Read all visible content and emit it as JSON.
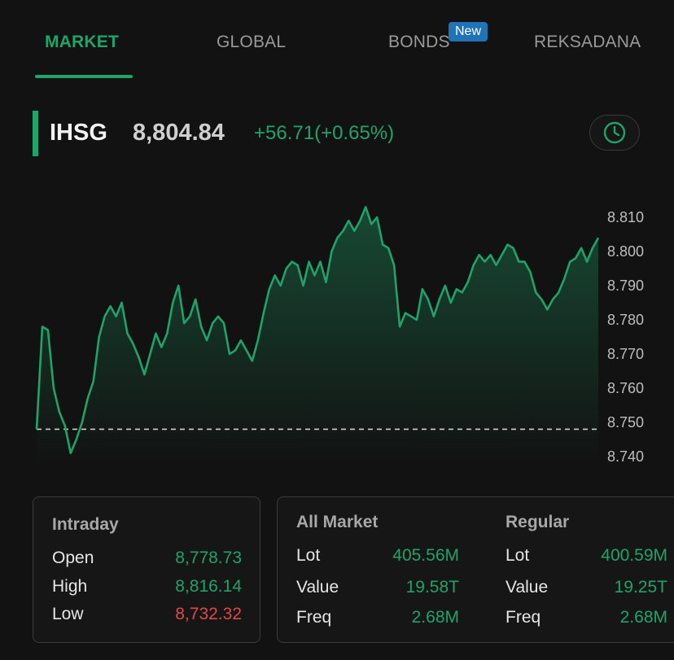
{
  "tabs": [
    {
      "label": "MARKET",
      "active": true
    },
    {
      "label": "GLOBAL",
      "active": false
    },
    {
      "label": "BONDS",
      "active": false,
      "badge": "New"
    },
    {
      "label": "REKSADANA",
      "active": false
    }
  ],
  "index": {
    "name": "IHSG",
    "value": "8,804.84",
    "change": "+56.71(+0.65%)"
  },
  "icons": {
    "history": "clock-icon"
  },
  "colors": {
    "up": "#1fa36b",
    "down": "#e04848",
    "badge": "#1f73b6"
  },
  "chart_data": {
    "type": "area",
    "ylim": [
      8.738,
      8.816
    ],
    "yticks": [
      "8.810",
      "8.800",
      "8.790",
      "8.780",
      "8.770",
      "8.760",
      "8.750",
      "8.740"
    ],
    "baseline": 8.748,
    "x": [
      0,
      1,
      2,
      3,
      4,
      5,
      6,
      7,
      8,
      9,
      10,
      11,
      12,
      13,
      14,
      15,
      16,
      17,
      18,
      19,
      20,
      21,
      22,
      23,
      24,
      25,
      26,
      27,
      28,
      29,
      30,
      31,
      32,
      33,
      34,
      35,
      36,
      37,
      38,
      39,
      40,
      41,
      42,
      43,
      44,
      45,
      46,
      47,
      48,
      49,
      50,
      51,
      52,
      53,
      54,
      55,
      56,
      57,
      58,
      59,
      60,
      61,
      62,
      63,
      64,
      65,
      66,
      67,
      68,
      69,
      70,
      71,
      72,
      73,
      74,
      75,
      76,
      77,
      78,
      79,
      80,
      81,
      82,
      83,
      84,
      85,
      86,
      87,
      88,
      89,
      90,
      91,
      92,
      93,
      94,
      95,
      96,
      97,
      98,
      99
    ],
    "values": [
      8.748,
      8.778,
      8.777,
      8.76,
      8.753,
      8.749,
      8.741,
      8.745,
      8.75,
      8.757,
      8.762,
      8.775,
      8.781,
      8.784,
      8.781,
      8.785,
      8.776,
      8.773,
      8.769,
      8.764,
      8.77,
      8.776,
      8.772,
      8.776,
      8.785,
      8.79,
      8.779,
      8.781,
      8.786,
      8.778,
      8.774,
      8.779,
      8.781,
      8.779,
      8.77,
      8.771,
      8.774,
      8.771,
      8.768,
      8.774,
      8.782,
      8.789,
      8.793,
      8.79,
      8.795,
      8.797,
      8.796,
      8.79,
      8.797,
      8.793,
      8.797,
      8.791,
      8.8,
      8.804,
      8.806,
      8.809,
      8.806,
      8.809,
      8.813,
      8.808,
      8.81,
      8.802,
      8.801,
      8.796,
      8.778,
      8.782,
      8.781,
      8.78,
      8.789,
      8.786,
      8.781,
      8.786,
      8.79,
      8.785,
      8.789,
      8.788,
      8.791,
      8.796,
      8.799,
      8.797,
      8.799,
      8.796,
      8.799,
      8.802,
      8.801,
      8.797,
      8.797,
      8.794,
      8.788,
      8.786,
      8.783,
      8.786,
      8.788,
      8.792,
      8.797,
      8.798,
      8.801,
      8.797,
      8.801,
      8.804
    ]
  },
  "intraday": {
    "title": "Intraday",
    "rows": [
      {
        "label": "Open",
        "value": "8,778.73"
      },
      {
        "label": "High",
        "value": "8,816.14"
      },
      {
        "label": "Low",
        "value": "8,732.32"
      }
    ]
  },
  "market": {
    "all_title": "All Market",
    "regular_title": "Regular",
    "all": [
      {
        "label": "Lot",
        "value": "405.56M"
      },
      {
        "label": "Value",
        "value": "19.58T"
      },
      {
        "label": "Freq",
        "value": "2.68M"
      }
    ],
    "regular": [
      {
        "label": "Lot",
        "value": "400.59M"
      },
      {
        "label": "Value",
        "value": "19.25T"
      },
      {
        "label": "Freq",
        "value": "2.68M"
      }
    ]
  }
}
